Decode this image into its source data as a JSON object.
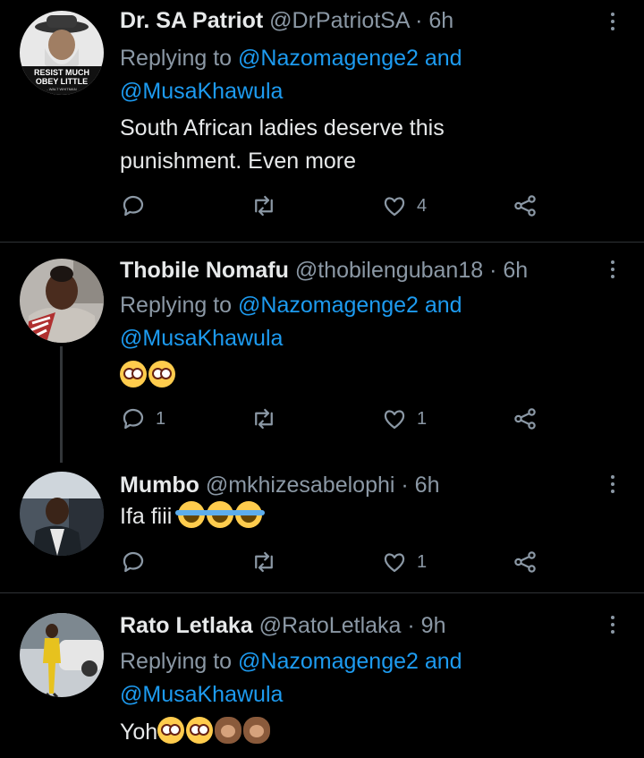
{
  "tweets": [
    {
      "name": "Dr. SA Patriot",
      "handle": "@DrPatriotSA",
      "sep": "·",
      "time": "6h",
      "replying_prefix": "Replying to",
      "mentions": "@Nazomagenge2 and",
      "mentions2": "@MusaKhawula",
      "text_line1": "South African ladies deserve this",
      "text_line2": "punishment. Even more",
      "avatar_text1": "RESIST MUCH",
      "avatar_text2": "OBEY LITTLE",
      "avatar_text3": "- WALT WHITMAN",
      "reply_count": "",
      "retweet_count": "",
      "like_count": "4"
    },
    {
      "name": "Thobile Nomafu",
      "handle": "@thobilenguban18",
      "sep": "·",
      "time": "6h",
      "replying_prefix": "Replying to",
      "mentions": "@Nazomagenge2 and",
      "mentions2": "@MusaKhawula",
      "reply_count": "1",
      "retweet_count": "",
      "like_count": "1"
    },
    {
      "name": "Mumbo",
      "handle": "@mkhizesabelophi",
      "sep": "·",
      "time": "6h",
      "text": "Ifa fiii",
      "reply_count": "",
      "retweet_count": "",
      "like_count": "1"
    },
    {
      "name": "Rato Letlaka",
      "handle": "@RatoLetlaka",
      "sep": "·",
      "time": "9h",
      "replying_prefix": "Replying to",
      "mentions": "@Nazomagenge2 and",
      "mentions2": "@MusaKhawula",
      "text": "Yoh"
    }
  ],
  "icons": {
    "reply": "reply-icon",
    "retweet": "retweet-icon",
    "like": "heart-icon",
    "share": "share-icon",
    "more": "more-icon"
  },
  "colors": {
    "background": "#000000",
    "text": "#e7e9ea",
    "muted": "#8b98a5",
    "link": "#1d9bf0",
    "divider": "#2f3336"
  }
}
